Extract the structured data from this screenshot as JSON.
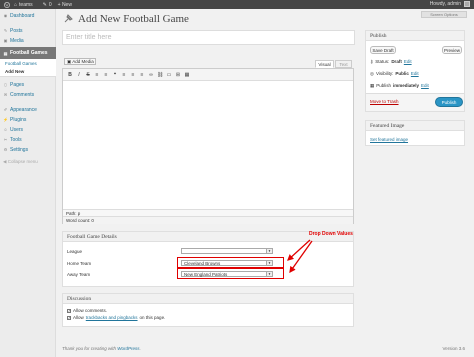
{
  "adminbar": {
    "site_name": "teams",
    "comments": "0",
    "new_label": "+ New",
    "howdy": "Howdy, admin"
  },
  "sidebar": {
    "items": [
      {
        "label": "Dashboard",
        "icon": "dashboard-icon"
      },
      {
        "label": "Posts",
        "icon": "pin-icon"
      },
      {
        "label": "Media",
        "icon": "media-icon"
      },
      {
        "label": "Football Games",
        "icon": "football-icon",
        "current": true
      },
      {
        "label": "Pages",
        "icon": "page-icon"
      },
      {
        "label": "Comments",
        "icon": "comment-icon"
      },
      {
        "label": "Appearance",
        "icon": "brush-icon"
      },
      {
        "label": "Plugins",
        "icon": "plug-icon"
      },
      {
        "label": "Users",
        "icon": "user-icon"
      },
      {
        "label": "Tools",
        "icon": "wrench-icon"
      },
      {
        "label": "Settings",
        "icon": "settings-icon"
      }
    ],
    "submenu": [
      "Football Games",
      "Add New"
    ],
    "collapse": "Collapse menu"
  },
  "page_title": "Add New Football Game",
  "screen_options": "Screen Options",
  "title_placeholder": "Enter title here",
  "editor": {
    "add_media": "Add Media",
    "tab_visual": "Visual",
    "tab_text": "Text",
    "toolbar": [
      "B",
      "I",
      "S",
      "≡",
      "≡",
      "❝",
      "≡",
      "≡",
      "≡",
      "∞",
      "⛓",
      "▭",
      "⊞",
      "▦"
    ],
    "path": "Path: p",
    "word_count": "Word count: 0"
  },
  "publish": {
    "title": "Publish",
    "save_draft": "Save Draft",
    "preview": "Preview",
    "status_label": "Status:",
    "status_value": "Draft",
    "visibility_label": "Visibility:",
    "visibility_value": "Public",
    "publish_label": "Publish",
    "publish_value": "immediately",
    "edit": "Edit",
    "trash": "Move to Trash",
    "publish_button": "Publish"
  },
  "featured": {
    "title": "Featured Image",
    "link": "Set featured image"
  },
  "game": {
    "title": "Football Game Details",
    "fields": [
      {
        "label": "League",
        "value": ""
      },
      {
        "label": "Home Team",
        "value": "Cleveland Browns"
      },
      {
        "label": "Away Team",
        "value": "New England Patriots"
      }
    ],
    "annotation": "Drop Down Values"
  },
  "discussion": {
    "title": "Discussion",
    "allow_comments": "Allow comments.",
    "allow_prefix": "Allow",
    "trackbacks_link": "trackbacks and pingbacks",
    "allow_suffix": "on this page."
  },
  "footer": {
    "thanks_prefix": "Thank you for creating with",
    "wordpress": "WordPress",
    "version": "Version 3.6"
  },
  "colors": {
    "accent": "#21759b",
    "publish_button": "#2a95c5",
    "annotation": "#e00000",
    "adminbar": "#464646"
  }
}
